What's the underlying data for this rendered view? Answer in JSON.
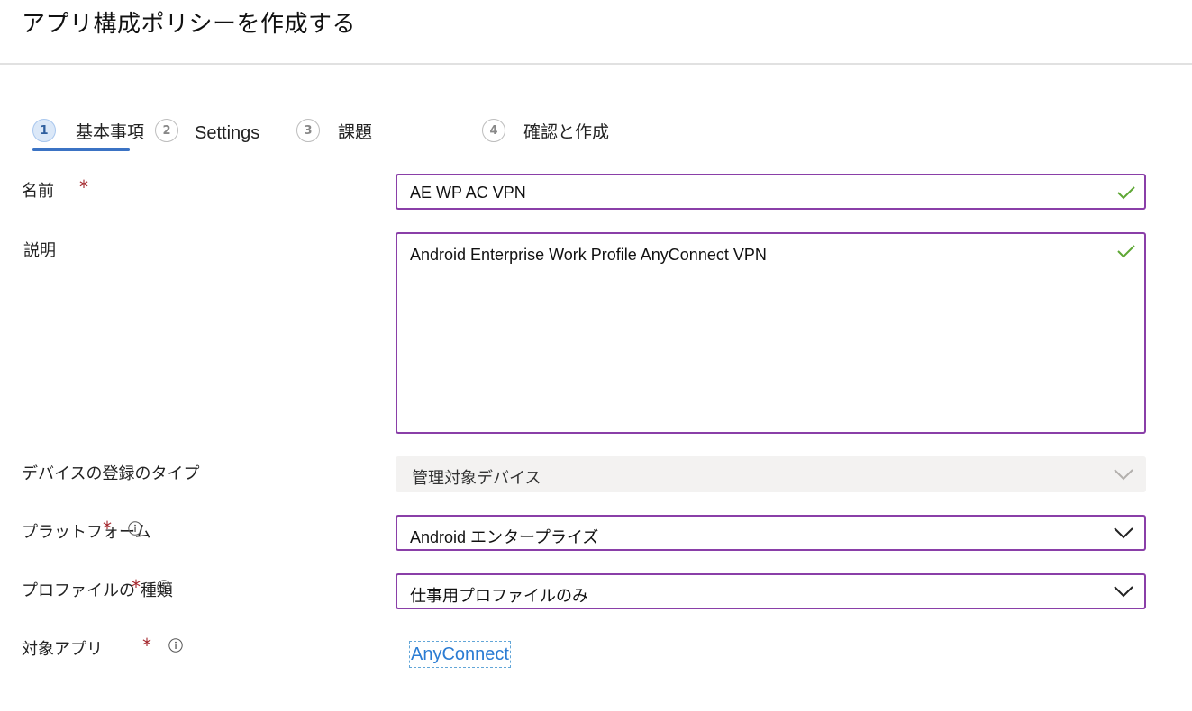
{
  "page": {
    "title": "アプリ構成ポリシーを作成する"
  },
  "steps": [
    {
      "num": "1",
      "label": "基本事項"
    },
    {
      "num": "2",
      "label": "Settings"
    },
    {
      "num": "3",
      "label": "課題"
    },
    {
      "num": "4",
      "label": "確認と作成"
    }
  ],
  "form": {
    "name": {
      "label": "名前",
      "required": "*",
      "value": "AE WP AC VPN"
    },
    "description": {
      "label": "説明",
      "value": "Android Enterprise Work Profile AnyConnect VPN"
    },
    "enrollment_type": {
      "label": "デバイスの登録のタイプ",
      "value": "管理対象デバイス"
    },
    "platform": {
      "label": "プラットフォーム",
      "required": "*",
      "value": "Android エンタープライズ"
    },
    "profile_type": {
      "label": "プロファイルの 種類",
      "required": "*",
      "value": "仕事用プロファイルのみ"
    },
    "target_app": {
      "label": "対象アプリ",
      "required": "*",
      "link_text": "AnyConnect"
    }
  },
  "colors": {
    "accent_border": "#8a3fa8",
    "check_green": "#5ea734",
    "required_red": "#a4262c",
    "active_step": "#3b73c4",
    "link": "#2b7cd3"
  },
  "icons": [
    "check-icon",
    "chevron-down-icon",
    "info-icon"
  ]
}
